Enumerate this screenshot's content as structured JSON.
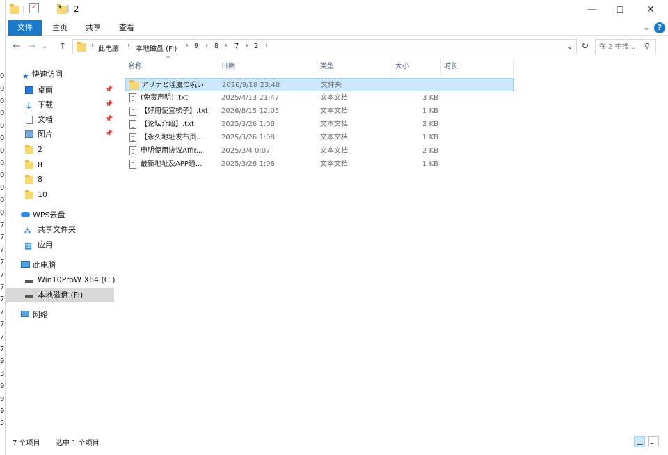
{
  "window": {
    "title": "2",
    "quick_access_dropdown": "▾",
    "minimize_glyph": "—",
    "maximize_glyph": "☐",
    "close_glyph": "✕"
  },
  "ribbon": {
    "tabs": [
      "文件",
      "主页",
      "共享",
      "查看"
    ],
    "expand_glyph": "⌄",
    "help_glyph": "?"
  },
  "nav": {
    "back": "←",
    "forward": "→",
    "dropdown": "⌄",
    "up": "↑",
    "breadcrumbs": [
      "此电脑",
      "本地磁盘 (F:)",
      "9",
      "8",
      "7",
      "2"
    ],
    "address_dropdown": "⌄",
    "refresh": "↻",
    "search_placeholder": "在 2 中搜...",
    "search_glyph": "⚲"
  },
  "sidebar": {
    "quick_access": "快速访问",
    "items": [
      {
        "label": "桌面",
        "pinned": true,
        "icon": "desktop-icon"
      },
      {
        "label": "下载",
        "pinned": true,
        "icon": "download-icon"
      },
      {
        "label": "文档",
        "pinned": true,
        "icon": "document-icon"
      },
      {
        "label": "图片",
        "pinned": true,
        "icon": "pictures-icon"
      },
      {
        "label": "2",
        "pinned": false,
        "icon": "folder-icon"
      },
      {
        "label": "8",
        "pinned": false,
        "icon": "folder-icon"
      },
      {
        "label": "8",
        "pinned": false,
        "icon": "folder-icon"
      },
      {
        "label": "10",
        "pinned": false,
        "icon": "folder-icon"
      }
    ],
    "wps": "WPS云盘",
    "shared": "共享文件夹",
    "apps": "应用",
    "this_pc": "此电脑",
    "drives": [
      "Win10ProW X64 (C:)",
      "本地磁盘 (F:)"
    ],
    "network": "网络",
    "pin_glyph": "📌"
  },
  "table": {
    "sort_glyph": "^",
    "columns": [
      "名称",
      "日期",
      "类型",
      "大小",
      "时长"
    ],
    "rows": [
      {
        "name": "アリナと淫魔の呪い",
        "date": "2026/9/18 23:48",
        "type": "文件夹",
        "size": "",
        "kind": "folder"
      },
      {
        "name": "(免责声明) .txt",
        "date": "2025/4/13 21:47",
        "type": "文本文档",
        "size": "3 KB",
        "kind": "txt"
      },
      {
        "name": "【好用使宜梯子】.txt",
        "date": "2026/8/15 12:05",
        "type": "文本文档",
        "size": "1 KB",
        "kind": "txt"
      },
      {
        "name": "【论坛介绍】.txt",
        "date": "2025/3/26 1:08",
        "type": "文本文档",
        "size": "2 KB",
        "kind": "txt"
      },
      {
        "name": "【永久地址发布页...",
        "date": "2025/3/26 1:08",
        "type": "文本文档",
        "size": "1 KB",
        "kind": "txt"
      },
      {
        "name": "申明使用协议Affir...",
        "date": "2025/3/4 0:07",
        "type": "文本文档",
        "size": "2 KB",
        "kind": "txt"
      },
      {
        "name": "最新地址及APP通...",
        "date": "2025/3/26 1:08",
        "type": "文本文档",
        "size": "1 KB",
        "kind": "txt"
      }
    ]
  },
  "status": {
    "count": "7 个项目",
    "selected": "选中 1 个项目"
  },
  "left_strip_chars": [
    "0",
    "0",
    "0",
    "0",
    "0",
    "0",
    "0",
    "0",
    "0",
    "0",
    "0",
    "0",
    "7",
    "7",
    "7",
    "7",
    "7",
    "7",
    "7",
    "7",
    "7",
    "7",
    "7",
    "9",
    "3",
    "9",
    "9",
    "9",
    "5"
  ]
}
